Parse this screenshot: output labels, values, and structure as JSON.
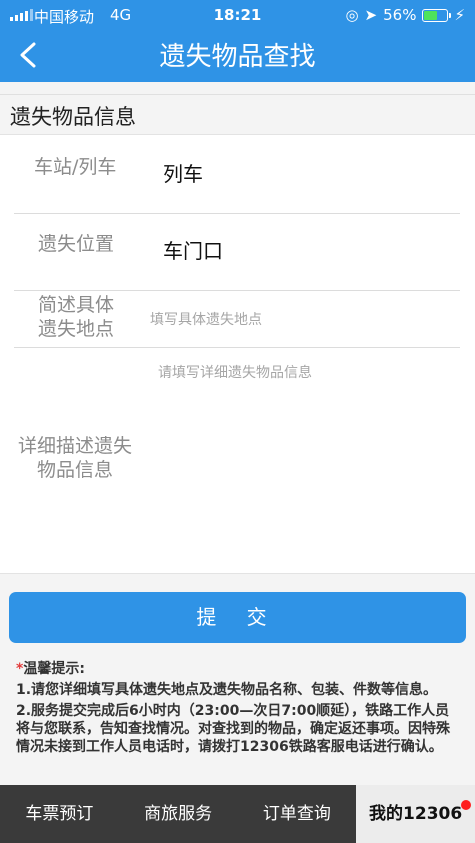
{
  "status_bar": {
    "carrier": "中国移动",
    "network": "4G",
    "time": "18:21",
    "battery": "56%",
    "battery_level": 0.56
  },
  "header": {
    "title": "遗失物品查找",
    "back_icon": "chevron-left-icon"
  },
  "section": {
    "title": "遗失物品信息"
  },
  "form": {
    "station_label": "车站/列车",
    "station_value": "列车",
    "location_label": "遗失位置",
    "location_value": "车门口",
    "brief_label_line1": "简述具体",
    "brief_label_line2": "遗失地点",
    "brief_placeholder": "填写具体遗失地点",
    "detail_placeholder": "请填写详细遗失物品信息",
    "detail_label_line1": "详细描述遗失",
    "detail_label_line2": "物品信息"
  },
  "submit_label": "提 交",
  "tips": {
    "star": "*",
    "title": "温馨提示:",
    "item1": "1.请您详细填写具体遗失地点及遗失物品名称、包装、件数等信息。",
    "item2": "2.服务提交完成后6小时内（23:00—次日7:00顺延），铁路工作人员将与您联系，告知查找情况。对查找到的物品，确定返还事项。因特殊情况未接到工作人员电话时，请拨打12306铁路客服电话进行确认。"
  },
  "tabbar": {
    "tab1": "车票预订",
    "tab2": "商旅服务",
    "tab3": "订单查询",
    "tab4": "我的12306"
  },
  "colors": {
    "primary": "#2f93e6",
    "tabbar_bg": "#3a3a3a",
    "badge": "#ff1e1e"
  }
}
